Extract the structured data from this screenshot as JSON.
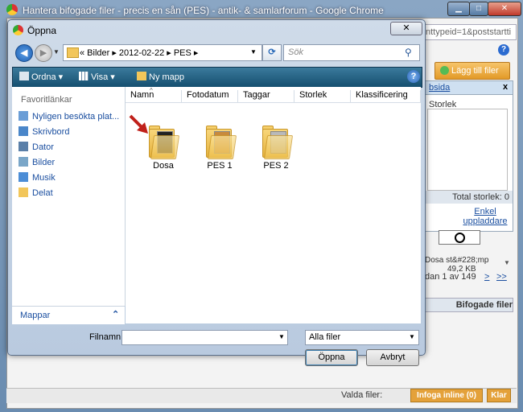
{
  "browser": {
    "title": "Hantera bifogade filer - precis en sån (PES) - antik- & samlarforum - Google Chrome",
    "url_fragment": "nttypeid=1&poststartti"
  },
  "background_page": {
    "add_files_label": "Lägg till filer",
    "panel_link": "bsida",
    "panel_close": "x",
    "size_header": "Storlek",
    "total_size": "Total storlek: 0",
    "simple_upload": "Enkel uppladdare",
    "thumb_name": "Dosa st&#228;mp",
    "thumb_size": "49,2 KB",
    "pager_text": "dan 1 av 149",
    "pager_next": ">",
    "pager_last": ">>",
    "attached_files": "Bifogade filer",
    "selected_files_label": "Valda filer:",
    "insert_inline": "Infoga inline (0)",
    "done": "Klar"
  },
  "dialog": {
    "title": "Öppna",
    "breadcrumb": "« Bilder ▸ 2012-02-22 ▸ PES ▸",
    "search_placeholder": "Sök",
    "toolbar": {
      "organize": "Ordna",
      "view": "Visa",
      "new_folder": "Ny mapp"
    },
    "favorites_header": "Favoritlänkar",
    "favorites": [
      {
        "label": "Nyligen besökta plat..."
      },
      {
        "label": "Skrivbord"
      },
      {
        "label": "Dator"
      },
      {
        "label": "Bilder"
      },
      {
        "label": "Musik"
      },
      {
        "label": "Delat"
      }
    ],
    "folders_label": "Mappar",
    "columns": [
      "Namn",
      "Fotodatum",
      "Taggar",
      "Storlek",
      "Klassificering"
    ],
    "files": [
      {
        "name": "Dosa"
      },
      {
        "name": "PES 1"
      },
      {
        "name": "PES 2"
      }
    ],
    "filename_label": "Filnamn:",
    "filename_value": "",
    "filetype_value": "Alla filer",
    "open_button": "Öppna",
    "cancel_button": "Avbryt"
  },
  "colors": {
    "toolbar": "#1f5f82",
    "link": "#1b4fa0",
    "orange": "#e4a13a"
  }
}
